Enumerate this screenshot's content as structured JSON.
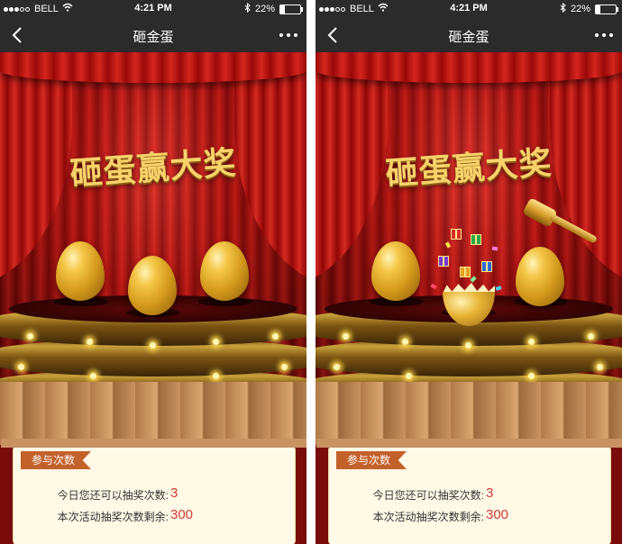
{
  "status_bar": {
    "carrier": "BELL",
    "time": "4:21 PM",
    "battery_percent": "22%",
    "battery_level": 0.22,
    "signal_icon": "signal-dots-icon",
    "wifi_icon": "wifi-icon",
    "bluetooth_icon": "bluetooth-icon"
  },
  "nav": {
    "title": "砸金蛋",
    "back_icon": "chevron-left-icon",
    "more_icon": "more-dots-icon"
  },
  "stage": {
    "headline": "砸蛋赢大奖"
  },
  "info": {
    "tag": "参与次数",
    "today_label": "今日您还可以抽奖次数:",
    "today_value": "3",
    "total_label": "本次活动抽奖次数剩余:",
    "total_value": "300"
  },
  "colors": {
    "accent_value": "#d23a3a",
    "tag_bg": "#c3612a",
    "nav_bg": "#2b2b2b",
    "gold": "#f5c84a"
  }
}
